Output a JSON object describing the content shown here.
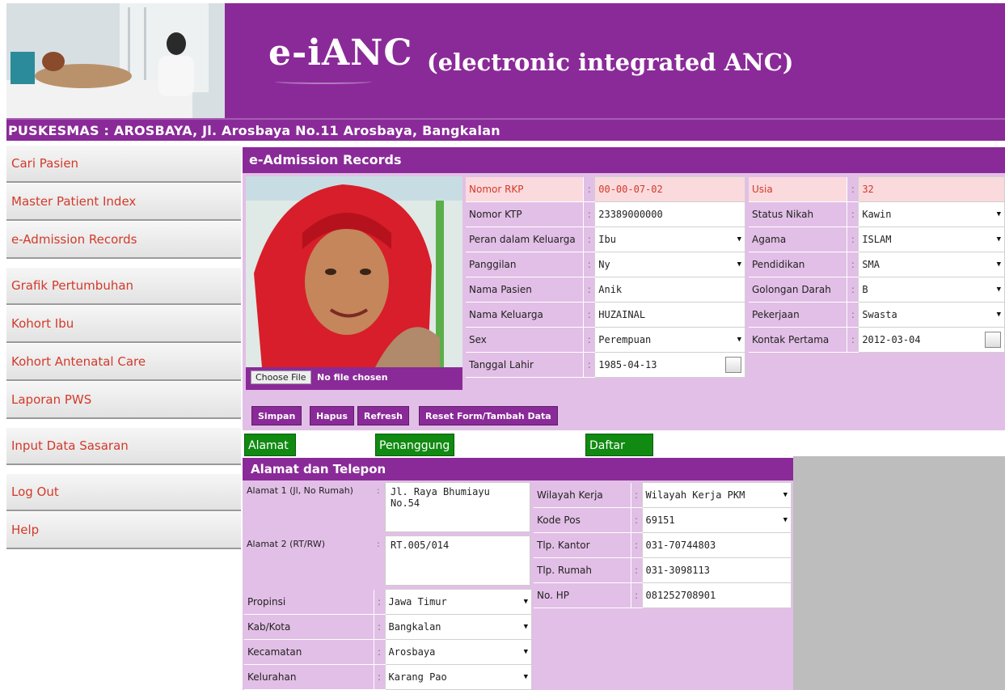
{
  "header": {
    "title": "e-iANC",
    "subtitle": "(electronic integrated ANC)",
    "facility": "PUSKESMAS : AROSBAYA, Jl. Arosbaya No.11 Arosbaya, Bangkalan"
  },
  "sidebar": {
    "items": [
      {
        "label": "Cari Pasien"
      },
      {
        "label": "Master Patient Index"
      },
      {
        "label": "e-Admission Records"
      },
      {
        "label": "Grafik Pertumbuhan"
      },
      {
        "label": "Kohort Ibu"
      },
      {
        "label": "Kohort Antenatal Care"
      },
      {
        "label": "Laporan PWS"
      },
      {
        "label": "Input Data Sasaran"
      },
      {
        "label": "Log Out"
      },
      {
        "label": "Help"
      }
    ]
  },
  "records": {
    "title": "e-Admission Records",
    "file": {
      "button": "Choose File",
      "status": "No file chosen"
    },
    "left_fields": [
      {
        "label": "Nomor RKP",
        "value": "00-00-07-02"
      },
      {
        "label": "Nomor KTP",
        "value": "23389000000"
      },
      {
        "label": "Peran dalam Keluarga",
        "value": "Ibu"
      },
      {
        "label": "Panggilan",
        "value": "Ny"
      },
      {
        "label": "Nama Pasien",
        "value": "Anik"
      },
      {
        "label": "Nama Keluarga",
        "value": "HUZAINAL"
      },
      {
        "label": "Sex",
        "value": "Perempuan"
      },
      {
        "label": "Tanggal Lahir",
        "value": "1985-04-13"
      }
    ],
    "right_fields": [
      {
        "label": "Usia",
        "value": "32"
      },
      {
        "label": "Status Nikah",
        "value": "Kawin"
      },
      {
        "label": "Agama",
        "value": "ISLAM"
      },
      {
        "label": "Pendidikan",
        "value": "SMA"
      },
      {
        "label": "Golongan Darah",
        "value": "B"
      },
      {
        "label": "Pekerjaan",
        "value": "Swasta"
      },
      {
        "label": "Kontak Pertama",
        "value": "2012-03-04"
      }
    ]
  },
  "buttons": {
    "save": "Simpan",
    "delete": "Hapus",
    "refresh": "Refresh",
    "reset": "Reset Form/Tambah Data"
  },
  "tabs": [
    {
      "label": "Alamat dan Telepon"
    },
    {
      "label": "Penanggung Jawab Pembayaran"
    },
    {
      "label": "Daftar Kunjungan"
    }
  ],
  "address": {
    "title": "Alamat dan Telepon",
    "alamat1_label": "Alamat 1 (Jl, No Rumah)",
    "alamat1_value": "Jl. Raya Bhumiayu No.54",
    "alamat2_label": "Alamat 2 (RT/RW)",
    "alamat2_value": "RT.005/014",
    "selects": [
      {
        "label": "Propinsi",
        "value": "Jawa Timur"
      },
      {
        "label": "Kab/Kota",
        "value": "Bangkalan"
      },
      {
        "label": "Kecamatan",
        "value": "Arosbaya"
      },
      {
        "label": "Kelurahan",
        "value": "Karang Pao"
      }
    ],
    "right": [
      {
        "label": "Wilayah Kerja",
        "value": "Wilayah Kerja PKM"
      },
      {
        "label": "Kode Pos",
        "value": "69151"
      },
      {
        "label": "Tlp. Kantor",
        "value": "031-70744803"
      },
      {
        "label": "Tlp. Rumah",
        "value": "031-3098113"
      },
      {
        "label": "No. HP",
        "value": "081252708901"
      }
    ]
  },
  "colors": {
    "purple": "#8a2a98",
    "lavender": "#e2bfe6",
    "green_tab": "#118a12",
    "menu_text": "#d23a2a"
  },
  "icons": [
    "calendar-icon",
    "dropdown-caret-icon"
  ]
}
